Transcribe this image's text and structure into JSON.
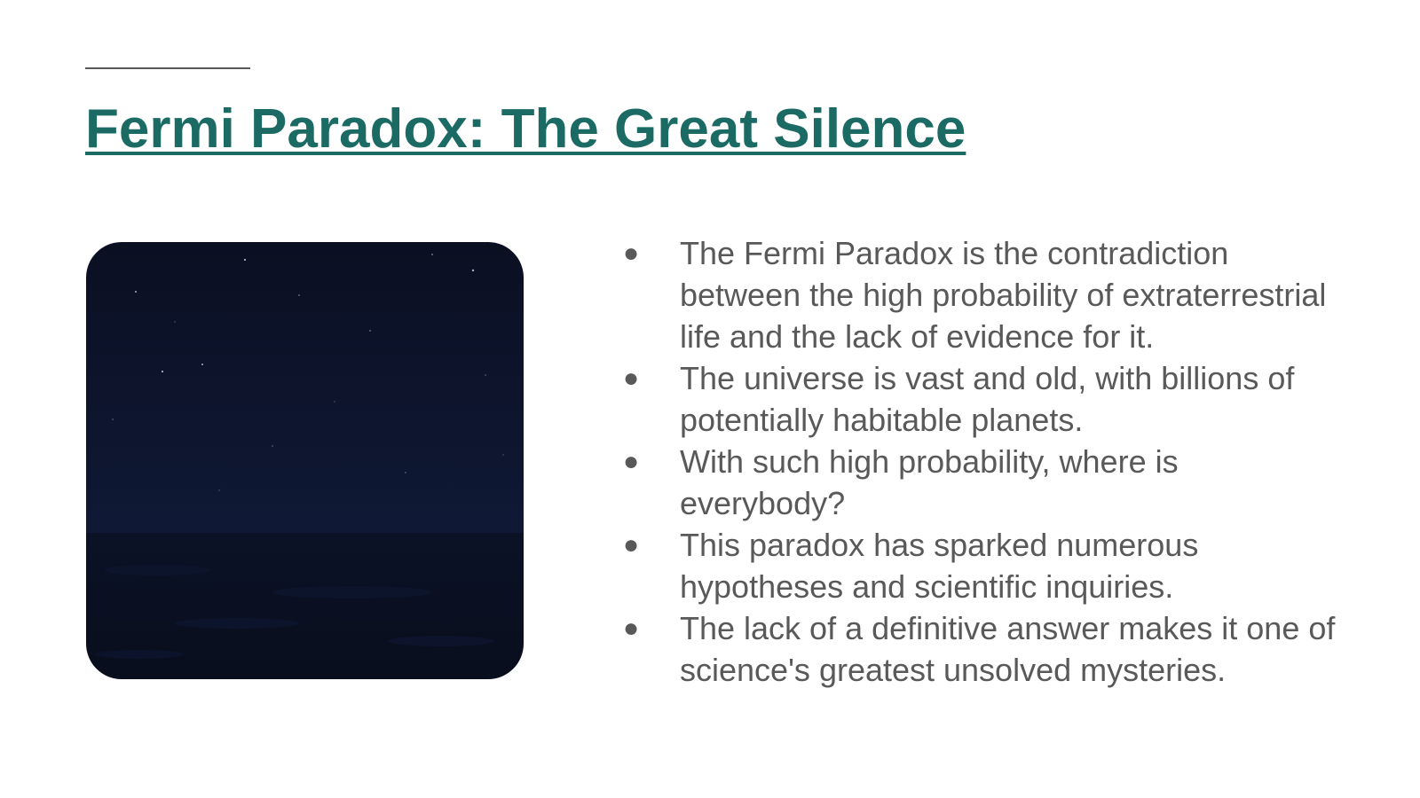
{
  "slide": {
    "title": "Fermi Paradox: The Great Silence",
    "bullet_glyph": "●",
    "bullets": [
      "The Fermi Paradox is the contradiction between the high probability of extraterrestrial life and the lack of evidence for it.",
      "The universe is vast and old, with billions of potentially habitable planets.",
      "With such high probability, where is everybody?",
      "This paradox has sparked numerous hypotheses and scientific inquiries.",
      "The lack of a definitive answer makes it one of science's greatest unsolved mysteries."
    ]
  },
  "colors": {
    "title": "#1b6b64",
    "body_text": "#595959",
    "accent_rule": "#595959",
    "sky_top": "#0b0f22",
    "sky_bottom": "#0f1935",
    "sea": "#0a0f1f"
  },
  "image": {
    "icon": "night-sky-over-sea-image"
  }
}
